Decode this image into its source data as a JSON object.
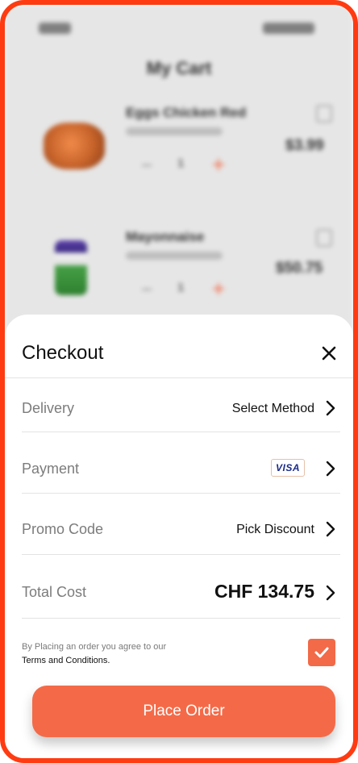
{
  "background_cart": {
    "title": "My Cart",
    "items": [
      {
        "name": "Eggs Chicken Red",
        "quantity": "1",
        "price": "$3.99"
      },
      {
        "name": "Mayonnaise",
        "quantity": "1",
        "price": "$50.75"
      }
    ]
  },
  "checkout": {
    "title": "Checkout",
    "rows": {
      "delivery": {
        "label": "Delivery",
        "value": "Select Method"
      },
      "payment": {
        "label": "Payment",
        "card_brand": "VISA"
      },
      "promo": {
        "label": "Promo Code",
        "value": "Pick Discount"
      },
      "total": {
        "label": "Total Cost",
        "value": "CHF 134.75"
      }
    },
    "agreement": {
      "text": "By Placing an order you agree to our",
      "link": "Terms and Conditions.",
      "checked": true
    },
    "place_order_label": "Place Order"
  },
  "colors": {
    "frame_border": "#ff3b12",
    "accent": "#f46a48",
    "label_gray": "#7c7c7c"
  },
  "icons": {
    "close": "close-icon",
    "chevron": "chevron-right-icon",
    "check": "check-icon",
    "delete": "trash-icon"
  }
}
